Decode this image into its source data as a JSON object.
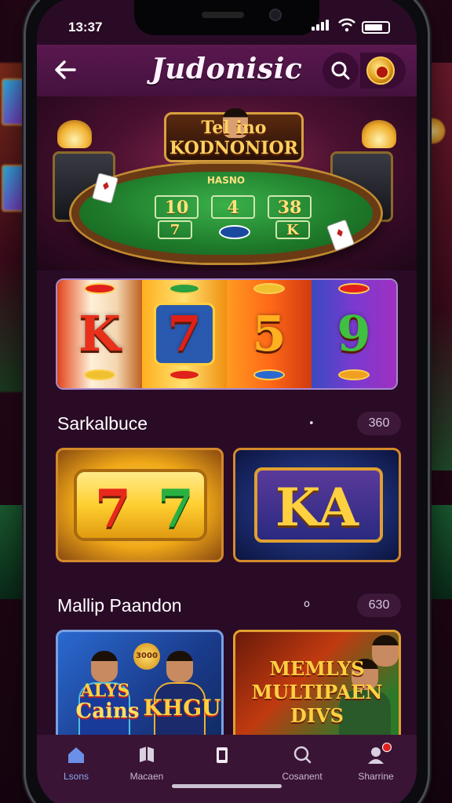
{
  "status_bar": {
    "time": "13:37"
  },
  "header": {
    "title": "Judonisic"
  },
  "hero": {
    "sign_line1": "Tel   ino",
    "sign_line2": "KODNONIOR",
    "table_label": "HASNO",
    "table_slots": [
      "10",
      "4",
      "38"
    ],
    "table_slots_row2": [
      "7",
      "K"
    ]
  },
  "reel_banner": {
    "symbols": [
      "K",
      "7",
      "5",
      "9"
    ]
  },
  "section1": {
    "title": "Sarkalbuce",
    "count": "360",
    "dot": "•"
  },
  "section1_cards": [
    {
      "name": "slot-777",
      "text_left": "7",
      "text_right": "7"
    },
    {
      "name": "slot-ka",
      "text": "KA"
    }
  ],
  "section2": {
    "title": "Mallip  Paandon",
    "count": "630",
    "dot": "o"
  },
  "section2_cards": [
    {
      "name": "promo-alys",
      "line1": "ALYS",
      "line2": "Cains",
      "line3": "KHGU",
      "badge": "3000"
    },
    {
      "name": "promo-memlys",
      "line1": "MEMLYS",
      "line2": "MULTIPAEN",
      "line3": "DIVS"
    }
  ],
  "tabs": [
    {
      "label": "Lsons",
      "icon": "home-icon",
      "active": true
    },
    {
      "label": "Macaen",
      "icon": "book-icon",
      "active": false
    },
    {
      "label": "",
      "icon": "card-icon",
      "active": false
    },
    {
      "label": "Cosanent",
      "icon": "search-icon",
      "active": false
    },
    {
      "label": "Sharrine",
      "icon": "profile-icon",
      "active": false
    }
  ],
  "colors": {
    "accent": "#8aa8f0",
    "header_bg": "#5a1850",
    "screen_bg": "#2a0b26"
  }
}
